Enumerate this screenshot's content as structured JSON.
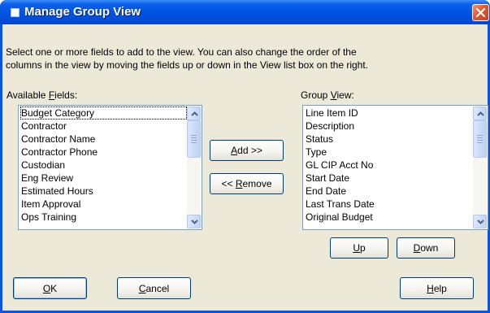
{
  "window": {
    "title": "Manage Group View"
  },
  "intro": {
    "line1": "Select one or more fields to add to the view. You can also change the order of the",
    "line2": "columns in the view by moving the fields up or down in the View list box on the right."
  },
  "available": {
    "label_pre": "Available ",
    "label_accel": "F",
    "label_post": "ields:",
    "items": [
      "Budget Category",
      "Contractor",
      "Contractor Name",
      "Contractor Phone",
      "Custodian",
      "Eng Review",
      "Estimated Hours",
      "Item Approval",
      "Ops Training"
    ]
  },
  "group": {
    "label_pre": "Group ",
    "label_accel": "V",
    "label_post": "iew:",
    "items": [
      "Line Item ID",
      "Description",
      "Status",
      "Type",
      "GL CIP Acct No",
      "Start Date",
      "End Date",
      "Last Trans Date",
      "Original Budget"
    ]
  },
  "buttons": {
    "add_accel": "A",
    "add_rest": "dd >>",
    "remove_pre": "<< ",
    "remove_accel": "R",
    "remove_rest": "emove",
    "up_accel": "U",
    "up_rest": "p",
    "down_accel": "D",
    "down_rest": "own",
    "ok_accel": "O",
    "ok_rest": "K",
    "cancel_accel": "C",
    "cancel_rest": "ancel",
    "help_accel": "H",
    "help_rest": "elp"
  },
  "colors": {
    "titlebar": "#0053E1",
    "face": "#ECE9D8",
    "close": "#E0582F"
  },
  "icons": {
    "window": "window-icon",
    "close": "close-icon"
  }
}
